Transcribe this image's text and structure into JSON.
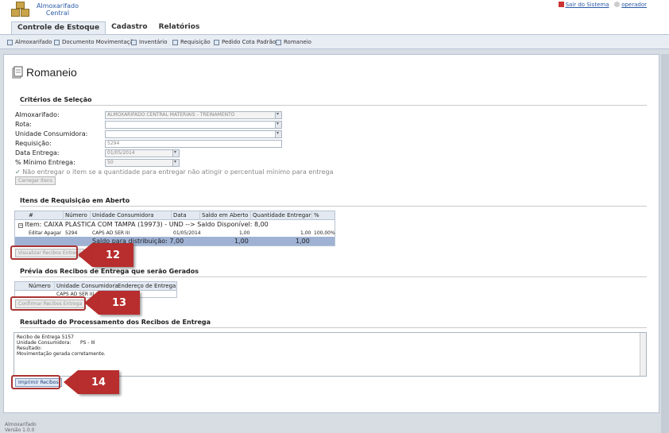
{
  "header": {
    "app_name_line1": "Almoxarifado",
    "app_name_line2": "Central",
    "logout": "Sair do Sistema",
    "user": "operador"
  },
  "tabs": [
    {
      "label": "Controle de Estoque"
    },
    {
      "label": "Cadastro"
    },
    {
      "label": "Relatórios"
    }
  ],
  "toolbar": [
    {
      "label": "Almoxarifado"
    },
    {
      "label": "Documento Movimentação"
    },
    {
      "label": "Inventário"
    },
    {
      "label": "Requisição"
    },
    {
      "label": "Pedido Cota Padrão"
    },
    {
      "label": "Romaneio"
    }
  ],
  "page": {
    "title": "Romaneio"
  },
  "criteria": {
    "section_title": "Critérios de Seleção",
    "almox_label": "Almoxarifado:",
    "almox_value": "ALMOXARIFADO CENTRAL MATERIAIS - TREINAMENTO",
    "rota_label": "Rota:",
    "unidade_label": "Unidade Consumidora:",
    "requisicao_label": "Requisição:",
    "requisicao_value": "5294",
    "data_label": "Data Entrega:",
    "data_value": "01/05/2014",
    "minimo_label": "% Mínimo Entrega:",
    "minimo_value": "50",
    "checkbox_label": "Não entregar o item se a quantidade para entregar não atingir o percentual mínimo para entrega",
    "load_button": "Carregar Itens"
  },
  "itens": {
    "section_title": "Itens de Requisição em Aberto",
    "columns": [
      "#",
      "Número",
      "Unidade Consumidora",
      "Data",
      "Saldo em Aberto",
      "Quantidade Entregar",
      "%"
    ],
    "group_row": "Item: CAIXA PLASTICA COM TAMPA (19973) - UND --> Saldo Disponível: 8,00",
    "row": {
      "actions": "Editar Apagar",
      "numero": "5294",
      "unidade": "CAPS AD SER III",
      "data": "01/05/2014",
      "saldo": "1,00",
      "quantidade": "1,00",
      "pct": "100,00%"
    },
    "summary": {
      "text": "Saldo para distribuição: 7,00",
      "saldo": "1,00",
      "quantidade": "1,00"
    },
    "button": "Visualizar Recibos Entrega"
  },
  "previa": {
    "section_title": "Prévia dos Recibos de Entrega que serão Gerados",
    "columns": [
      "Número",
      "Unidade Consumidora",
      "Endereço de Entrega"
    ],
    "row_unidade": "CAPS AD SER III",
    "button": "Confirmar Recibos Entrega"
  },
  "resultado": {
    "section_title": "Resultado do Processamento dos Recibos de Entrega",
    "lines": [
      "Recibo de Entrega 5157",
      "Unidade Consumidora:      PS - III",
      "Resultado:",
      "Movimentação gerada corretamente."
    ],
    "button": "Imprimir Recibos"
  },
  "callouts": [
    "12",
    "13",
    "14"
  ],
  "footer": {
    "line1": "Almoxarifado",
    "line2": "Versão 1.0.0"
  },
  "colors": {
    "accent": "#2b5aa6",
    "callout": "#b82d2d",
    "grid_header": "#e3e9f1",
    "summary_row": "#9fb2d4"
  }
}
